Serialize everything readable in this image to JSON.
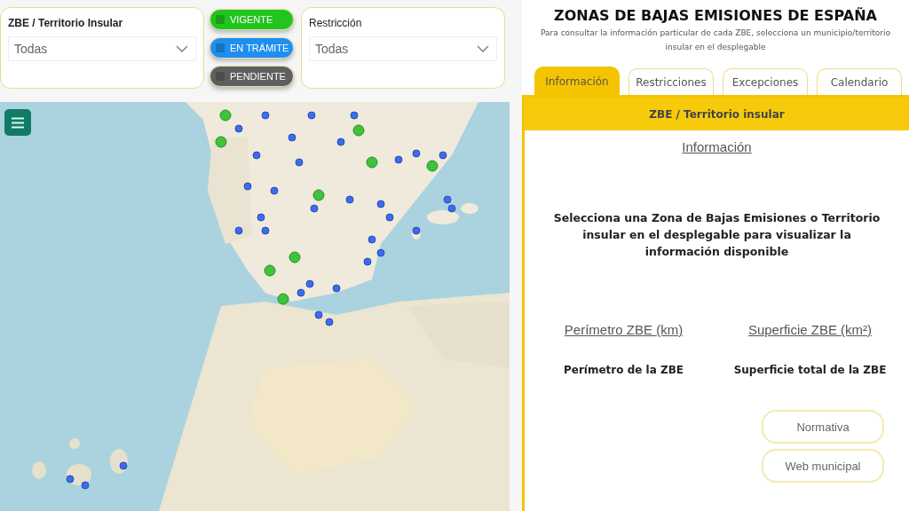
{
  "filters": [
    {
      "label": "ZBE / Territorio Insular",
      "value": "Todas"
    },
    {
      "label": "Restricción",
      "value": "Todas"
    }
  ],
  "legend": [
    {
      "label": "VIGENTE",
      "color": "#22c41e"
    },
    {
      "label": "EN TRÁMITE",
      "color": "#1e8ff0"
    },
    {
      "label": "PENDIENTE",
      "color": "#5f5f5f"
    }
  ],
  "header": {
    "title": "ZONAS DE BAJAS EMISIONES DE ESPAÑA",
    "subtitle": "Para consultar la información particular de cada ZBE, selecciona un municipio/territorio insular en el desplegable"
  },
  "tabs": [
    {
      "label": "Información",
      "selected": true
    },
    {
      "label": "Restricciones",
      "selected": false
    },
    {
      "label": "Excepciones",
      "selected": false
    },
    {
      "label": "Calendario",
      "selected": false
    }
  ],
  "panel": {
    "heading": "ZBE / Territorio insular",
    "section": "Información",
    "message": "Selecciona una Zona de Bajas Emisiones o Territorio insular en el desplegable para visualizar la información disponible",
    "metrics": [
      {
        "title": "Perímetro ZBE (km)",
        "value": "Perímetro de la ZBE"
      },
      {
        "title": "Superficie ZBE (km²)",
        "value": "Superficie total de la ZBE"
      }
    ],
    "buttons": [
      "Normativa",
      "Web municipal"
    ]
  }
}
